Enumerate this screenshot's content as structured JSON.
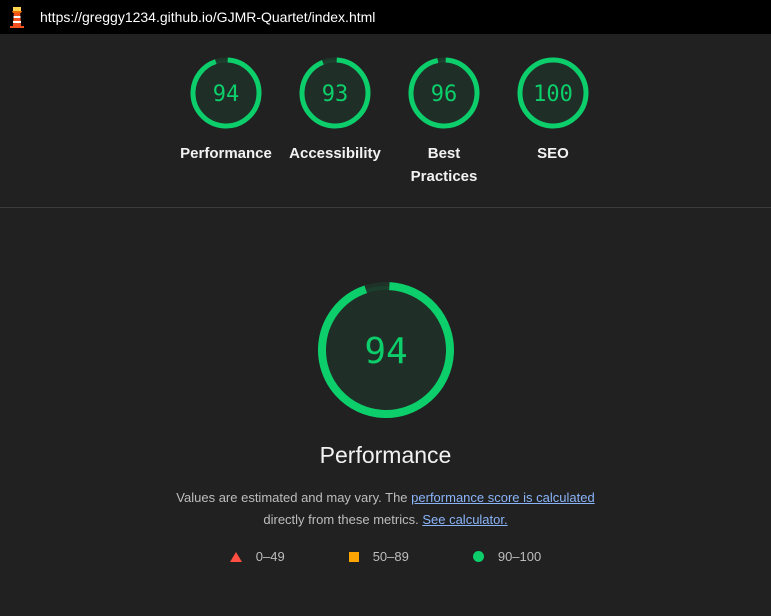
{
  "header": {
    "url": "https://greggy1234.github.io/GJMR-Quartet/index.html",
    "logo_icon": "lighthouse-icon"
  },
  "colors": {
    "pass": "#0cce6b",
    "average": "#ffa400",
    "fail": "#ff4e42",
    "link": "#8ab4f8"
  },
  "categories": [
    {
      "score": 94,
      "label": "Performance"
    },
    {
      "score": 93,
      "label": "Accessibility"
    },
    {
      "score": 96,
      "label": "Best Practices"
    },
    {
      "score": 100,
      "label": "SEO"
    }
  ],
  "main": {
    "score": 94,
    "title": "Performance",
    "desc_text1": "Values are estimated and may vary. The",
    "desc_link1": "performance score is calculated",
    "desc_text2": "directly from these metrics.",
    "desc_link2": "See calculator.",
    "legend": [
      {
        "icon": "triangle-icon",
        "label": "0–49"
      },
      {
        "icon": "square-icon",
        "label": "50–89"
      },
      {
        "icon": "circle-icon",
        "label": "90–100"
      }
    ]
  }
}
